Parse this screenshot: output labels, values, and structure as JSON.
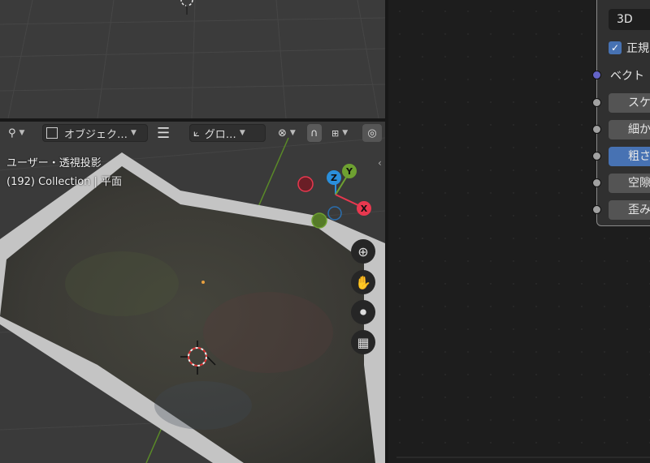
{
  "header": {
    "object_mode_label": "オブジェク…",
    "transform_orientation_label": "グロ…"
  },
  "viewport": {
    "view_label": "ユーザー・透視投影",
    "collection_label": "(192) Collection | 平面"
  },
  "gizmo": {
    "z": "Z",
    "y": "Y",
    "x": "X"
  },
  "node": {
    "dimension_value": "3D",
    "normalize_label": "正規",
    "vector_label": "ベクト",
    "inputs": [
      {
        "label": "スケ",
        "active": false
      },
      {
        "label": "細か",
        "active": false
      },
      {
        "label": "粗さ",
        "active": true
      },
      {
        "label": "空隙",
        "active": false
      },
      {
        "label": "歪み",
        "active": false
      }
    ]
  },
  "colors": {
    "accent": "#4772b3",
    "vector_socket": "#6363c7",
    "float_socket": "#a1a1a1",
    "axis_x": "#e8384f",
    "axis_y": "#6ea131",
    "axis_z": "#2a8fdb"
  }
}
